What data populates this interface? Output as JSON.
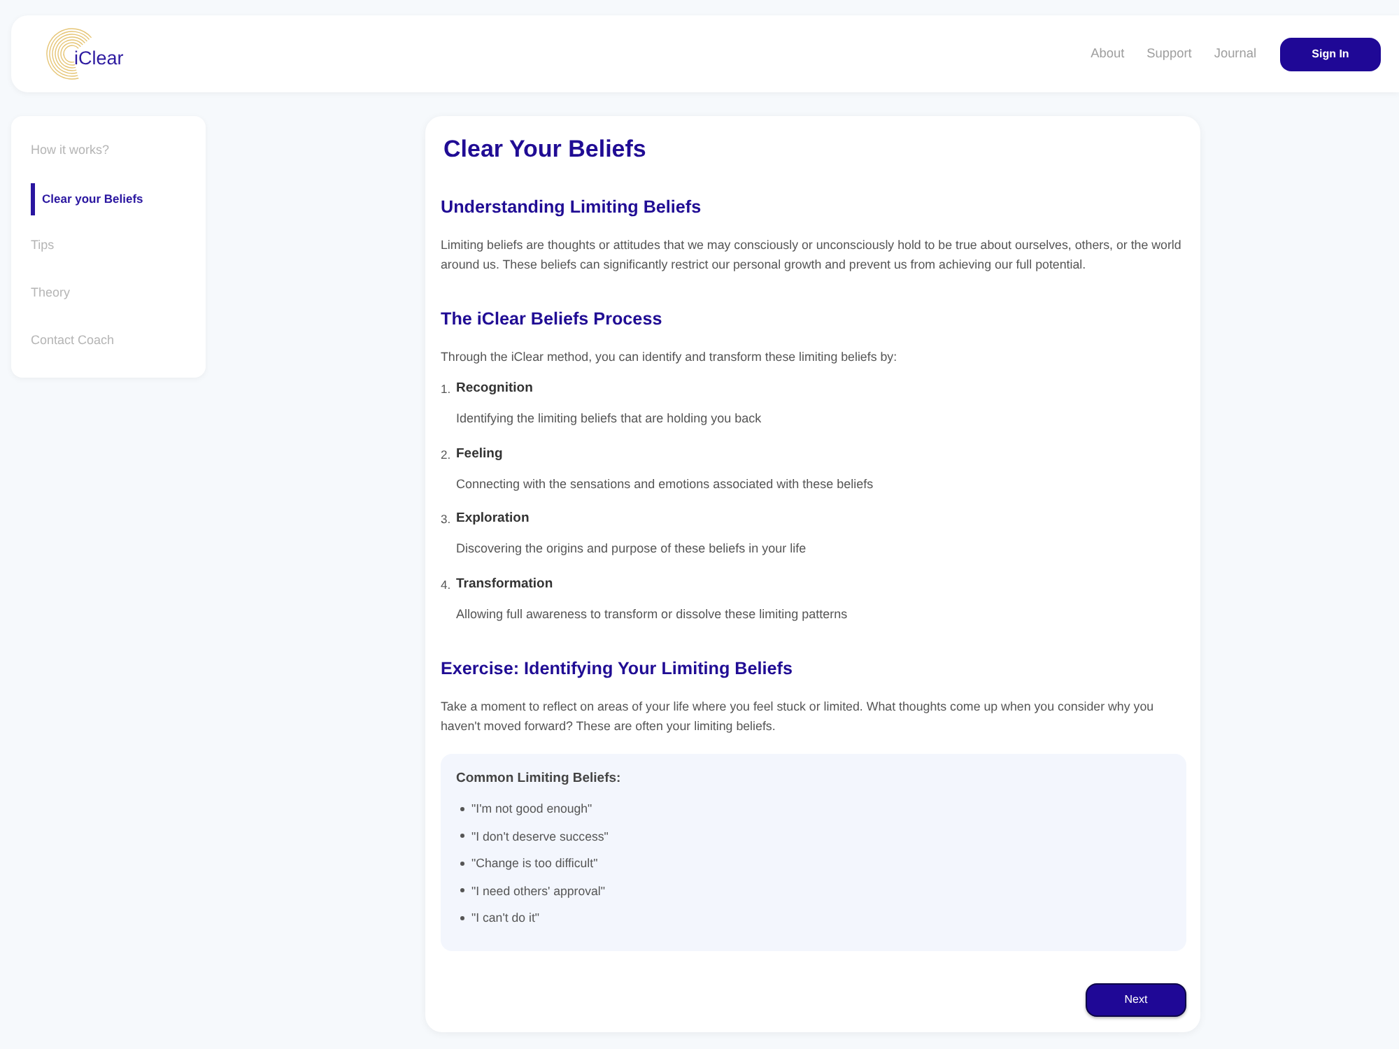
{
  "header": {
    "logo": {
      "text": "iClear"
    },
    "nav": [
      {
        "label": "About"
      },
      {
        "label": "Support"
      },
      {
        "label": "Journal"
      }
    ],
    "sign_in_button": "Sign In"
  },
  "sidebar": {
    "items": [
      {
        "label": "How it works?",
        "selected": false
      },
      {
        "label": "Clear your Beliefs",
        "selected": true
      },
      {
        "label": "Tips",
        "selected": false
      },
      {
        "label": "Theory",
        "selected": false
      },
      {
        "label": "Contact Coach",
        "selected": false
      }
    ]
  },
  "main": {
    "title": "Clear Your Beliefs",
    "sections": [
      {
        "heading": "Understanding Limiting Beliefs",
        "paragraph": "Limiting beliefs are thoughts or attitudes that we may consciously or unconsciously hold to be true about ourselves, others, or the world around us. These beliefs can significantly restrict our personal growth and prevent us from achieving our full potential."
      },
      {
        "heading": "The iClear Beliefs Process",
        "paragraph": "Through the iClear method, you can identify and transform these limiting beliefs by:",
        "steps": [
          {
            "number": "1.",
            "title": "Recognition",
            "description": "Identifying the limiting beliefs that are holding you back"
          },
          {
            "number": "2.",
            "title": "Feeling",
            "description": "Connecting with the sensations and emotions associated with these beliefs"
          },
          {
            "number": "3.",
            "title": "Exploration",
            "description": "Discovering the origins and purpose of these beliefs in your life"
          },
          {
            "number": "4.",
            "title": "Transformation",
            "description": "Allowing full awareness to transform or dissolve these limiting patterns"
          }
        ]
      },
      {
        "heading": "Exercise: Identifying Your Limiting Beliefs",
        "paragraph": "Take a moment to reflect on areas of your life where you feel stuck or limited. What thoughts come up when you consider why you haven't moved forward? These are often your limiting beliefs.",
        "callout": {
          "title": "Common Limiting Beliefs:",
          "items": [
            "\"I'm not good enough\"",
            "\"I don't deserve success\"",
            "\"Change is too difficult\"",
            "\"I need others' approval\"",
            "\"I can't do it\""
          ]
        }
      }
    ],
    "next_button": "Next"
  }
}
